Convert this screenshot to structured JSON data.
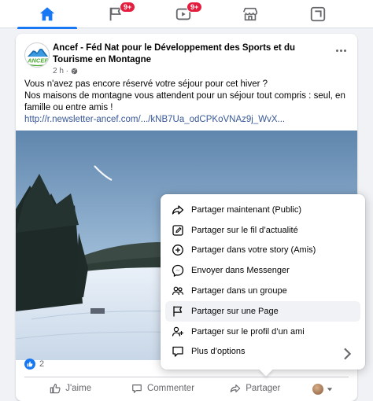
{
  "nav": {
    "tabs": [
      {
        "name": "home",
        "active": true,
        "badge": ""
      },
      {
        "name": "pages",
        "active": false,
        "badge": "9+"
      },
      {
        "name": "watch",
        "active": false,
        "badge": "9+"
      },
      {
        "name": "marketplace",
        "active": false,
        "badge": ""
      },
      {
        "name": "gaming",
        "active": false,
        "badge": ""
      }
    ]
  },
  "post": {
    "page_name": "Ancef - Féd Nat pour le Développement des Sports et du Tourisme en Montagne",
    "avatar_text": "ANCEF",
    "time": "2 h ·",
    "text_line1": "Vous n'avez pas encore réservé votre séjour pour cet hiver ?",
    "text_line2": "Nos maisons de montagne vous attendent pour un séjour tout compris : seul, en famille ou entre amis !",
    "link": "http://r.newsletter-ancef.com/.../kNB7Ua_odCPKoVNAz9j_WvX...",
    "reaction_count": "2"
  },
  "actions": {
    "like": "J'aime",
    "comment": "Commenter",
    "share": "Partager"
  },
  "share_menu": {
    "items": [
      {
        "label": "Partager maintenant (Public)",
        "icon": "share-arrow-icon"
      },
      {
        "label": "Partager sur le fil d’actualité",
        "icon": "edit-icon"
      },
      {
        "label": "Partager dans votre story (Amis)",
        "icon": "plus-circle-icon"
      },
      {
        "label": "Envoyer dans Messenger",
        "icon": "messenger-icon"
      },
      {
        "label": "Partager dans un groupe",
        "icon": "group-icon"
      },
      {
        "label": "Partager sur une Page",
        "icon": "flag-icon"
      },
      {
        "label": "Partager sur le profil d’un ami",
        "icon": "friend-icon"
      },
      {
        "label": "Plus d’options",
        "icon": "chat-icon"
      }
    ]
  },
  "colors": {
    "accent": "#1877f2",
    "badge": "#e41e3f",
    "link": "#385898"
  }
}
